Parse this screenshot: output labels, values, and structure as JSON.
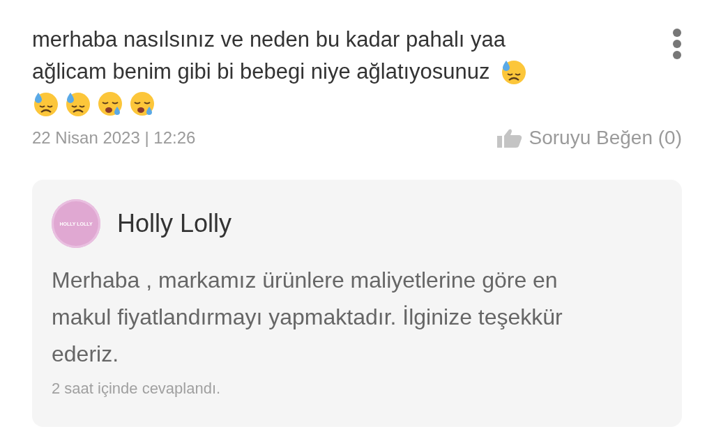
{
  "question": {
    "lines": [
      {
        "text": "merhaba nasılsınız ve neden bu kadar pahalı yaa"
      },
      {
        "text": "ağlicam benim gibi bi bebegi niye ağlatıyosunuz",
        "emojis": [
          {
            "kind": "sweat"
          }
        ]
      }
    ],
    "emoji_row": [
      {
        "kind": "sweat"
      },
      {
        "kind": "sweat"
      },
      {
        "kind": "sleepy"
      },
      {
        "kind": "sleepy"
      }
    ],
    "date": "22 Nisan 2023 | 12:26",
    "like_label": "Soruyu Beğen (0)"
  },
  "answer": {
    "avatar_text": "HOLLY LOLLY",
    "author": "Holly Lolly",
    "text": "Merhaba , markamız ürünlere maliyetlerine göre en makul fiyatlandırmayı yapmaktadır. İlginize teşekkür ederiz.",
    "time": "2 saat içinde cevaplandı."
  }
}
